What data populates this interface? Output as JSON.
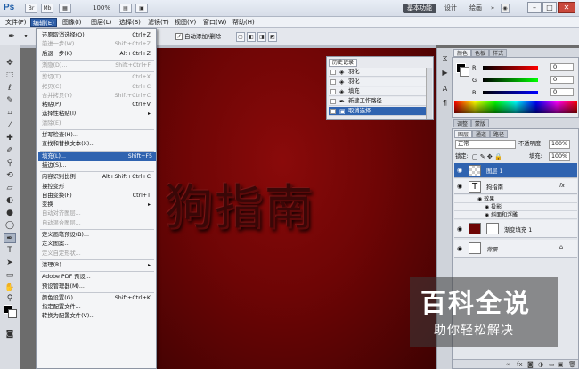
{
  "app": {
    "logo": "Ps",
    "zoom": "100%",
    "workspaces": [
      "基本功能",
      "设计",
      "绘画"
    ],
    "more": "»",
    "window_controls": [
      "–",
      "□",
      "✕"
    ]
  },
  "menubar": [
    "文件(F)",
    "编辑(E)",
    "图像(I)",
    "图层(L)",
    "选择(S)",
    "滤镜(T)",
    "视图(V)",
    "窗口(W)",
    "帮助(H)"
  ],
  "options_bar": {
    "auto_add_delete": "自动添加/删除"
  },
  "edit_menu": [
    {
      "label": "还原取消选择(O)",
      "shortcut": "Ctrl+Z",
      "disabled": false
    },
    {
      "label": "前进一步(W)",
      "shortcut": "Shift+Ctrl+Z",
      "disabled": true
    },
    {
      "label": "后退一步(K)",
      "shortcut": "Alt+Ctrl+Z",
      "disabled": false
    },
    {
      "sep": true
    },
    {
      "label": "渐隐(D)...",
      "shortcut": "Shift+Ctrl+F",
      "disabled": true
    },
    {
      "sep": true
    },
    {
      "label": "剪切(T)",
      "shortcut": "Ctrl+X",
      "disabled": true
    },
    {
      "label": "拷贝(C)",
      "shortcut": "Ctrl+C",
      "disabled": true
    },
    {
      "label": "合并拷贝(Y)",
      "shortcut": "Shift+Ctrl+C",
      "disabled": true
    },
    {
      "label": "粘贴(P)",
      "shortcut": "Ctrl+V",
      "disabled": false
    },
    {
      "label": "选择性粘贴(I)",
      "shortcut": "",
      "submenu": true,
      "disabled": false
    },
    {
      "label": "清除(E)",
      "shortcut": "",
      "disabled": true
    },
    {
      "sep": true
    },
    {
      "label": "拼写检查(H)...",
      "shortcut": "",
      "disabled": false
    },
    {
      "label": "查找和替换文本(X)...",
      "shortcut": "",
      "disabled": false
    },
    {
      "sep": true
    },
    {
      "label": "填充(L)...",
      "shortcut": "Shift+F5",
      "disabled": false,
      "highlighted": true
    },
    {
      "label": "描边(S)...",
      "shortcut": "",
      "disabled": false
    },
    {
      "sep": true
    },
    {
      "label": "内容识别比例",
      "shortcut": "Alt+Shift+Ctrl+C",
      "disabled": false
    },
    {
      "label": "操控变形",
      "shortcut": "",
      "disabled": false
    },
    {
      "label": "自由变换(F)",
      "shortcut": "Ctrl+T",
      "disabled": false
    },
    {
      "label": "变换",
      "shortcut": "",
      "submenu": true,
      "disabled": false
    },
    {
      "label": "自动对齐图层...",
      "shortcut": "",
      "disabled": true
    },
    {
      "label": "自动混合图层...",
      "shortcut": "",
      "disabled": true
    },
    {
      "sep": true
    },
    {
      "label": "定义画笔预设(B)...",
      "shortcut": "",
      "disabled": false
    },
    {
      "label": "定义图案...",
      "shortcut": "",
      "disabled": false
    },
    {
      "label": "定义自定形状...",
      "shortcut": "",
      "disabled": true
    },
    {
      "sep": true
    },
    {
      "label": "清理(R)",
      "shortcut": "",
      "submenu": true,
      "disabled": false
    },
    {
      "sep": true
    },
    {
      "label": "Adobe PDF 预设...",
      "shortcut": "",
      "disabled": false
    },
    {
      "label": "预设管理器(M)...",
      "shortcut": "",
      "disabled": false
    },
    {
      "sep": true
    },
    {
      "label": "颜色设置(G)...",
      "shortcut": "Shift+Ctrl+K",
      "disabled": false
    },
    {
      "label": "指定配置文件...",
      "shortcut": "",
      "disabled": false
    },
    {
      "label": "转换为配置文件(V)...",
      "shortcut": "",
      "disabled": false
    }
  ],
  "canvas": {
    "text": "狗指南",
    "color": "#6e0505"
  },
  "history": {
    "tab": "历史记录",
    "rows": [
      {
        "label": "羽化",
        "selected": false
      },
      {
        "label": "羽化",
        "selected": false
      },
      {
        "label": "填充",
        "selected": false
      },
      {
        "label": "新建工作路径",
        "selected": false
      },
      {
        "label": "取消选择",
        "selected": true
      }
    ]
  },
  "color_panel": {
    "tabs": [
      "颜色",
      "色板",
      "样式"
    ],
    "channels": [
      {
        "name": "R",
        "value": "0",
        "color": "#e00000"
      },
      {
        "name": "G",
        "value": "0",
        "color": "#00b000"
      },
      {
        "name": "B",
        "value": "0",
        "color": "#0000e0"
      }
    ]
  },
  "layers_panel": {
    "top_tabs": [
      "调整",
      "蒙版"
    ],
    "tabs": [
      "图层",
      "通道",
      "路径"
    ],
    "blend_mode": "正常",
    "opacity_label": "不透明度:",
    "opacity": "100%",
    "lock_label": "锁定:",
    "fill_label": "填充:",
    "fill": "100%",
    "layers": [
      {
        "name": "图层 1",
        "selected": true,
        "thumb": ""
      },
      {
        "name": "狗指南",
        "selected": false,
        "thumb": "T",
        "fx": "fx"
      },
      {
        "name": "渐变填充 1",
        "selected": false,
        "thumb": ""
      },
      {
        "name": "背景",
        "selected": false,
        "thumb": "",
        "locked": true
      }
    ],
    "effects_label": "效果",
    "effects": [
      "投影",
      "斜面和浮雕"
    ]
  },
  "watermark": {
    "title": "百科全说",
    "subtitle": "助你轻松解决"
  }
}
